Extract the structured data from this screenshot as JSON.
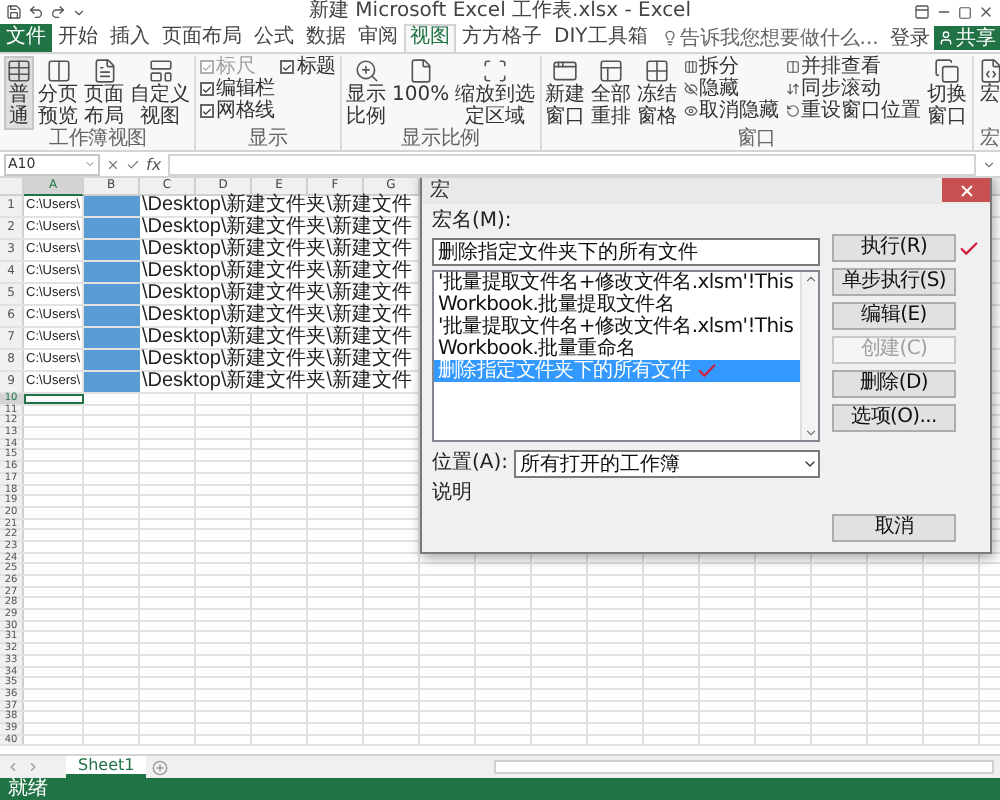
{
  "window": {
    "title": "新建 Microsoft Excel 工作表.xlsx - Excel"
  },
  "tabs": [
    {
      "label": "文件",
      "kind": "file",
      "selected": false
    },
    {
      "label": "开始",
      "kind": "tab",
      "selected": false
    },
    {
      "label": "插入",
      "kind": "tab",
      "selected": false
    },
    {
      "label": "页面布局",
      "kind": "tab",
      "selected": false
    },
    {
      "label": "公式",
      "kind": "tab",
      "selected": false
    },
    {
      "label": "数据",
      "kind": "tab",
      "selected": false
    },
    {
      "label": "审阅",
      "kind": "tab",
      "selected": false
    },
    {
      "label": "视图",
      "kind": "tab",
      "selected": true
    },
    {
      "label": "方方格子",
      "kind": "tab",
      "selected": false
    },
    {
      "label": "DIY工具箱",
      "kind": "tab",
      "selected": false
    }
  ],
  "tell_me": {
    "placeholder": "告诉我您想要做什么..."
  },
  "sign_in": "登录",
  "share": "共享",
  "ribbon": {
    "groups": [
      {
        "label": "工作簿视图",
        "items": [
          {
            "kind": "large",
            "label": "普通",
            "selected": true
          },
          {
            "kind": "large",
            "label": "分页预览",
            "selected": false
          },
          {
            "kind": "large",
            "label": "页面布局",
            "selected": false
          },
          {
            "kind": "large",
            "label": "自定义视图",
            "selected": false
          }
        ]
      },
      {
        "label": "显示",
        "items": [
          {
            "kind": "stack",
            "items": [
              {
                "kind": "check",
                "label": "标尺",
                "checked": true,
                "disabled": true
              },
              {
                "kind": "check",
                "label": "编辑栏",
                "checked": true,
                "disabled": false
              },
              {
                "kind": "check",
                "label": "网格线",
                "checked": true,
                "disabled": false
              }
            ]
          },
          {
            "kind": "stack",
            "items": [
              {
                "kind": "check",
                "label": "标题",
                "checked": true,
                "disabled": false
              }
            ]
          }
        ]
      },
      {
        "label": "显示比例",
        "items": [
          {
            "kind": "large",
            "label": "显示比例"
          },
          {
            "kind": "large",
            "label": "100%"
          },
          {
            "kind": "large",
            "label": "缩放到选定区域"
          }
        ]
      },
      {
        "label": "窗口",
        "items": [
          {
            "kind": "large",
            "label": "新建窗口"
          },
          {
            "kind": "large",
            "label": "全部重排"
          },
          {
            "kind": "large",
            "label": "冻结窗格"
          },
          {
            "kind": "stack",
            "items": [
              {
                "kind": "small",
                "label": "拆分"
              },
              {
                "kind": "small",
                "label": "隐藏"
              },
              {
                "kind": "small",
                "label": "取消隐藏"
              }
            ]
          },
          {
            "kind": "stack",
            "items": [
              {
                "kind": "small",
                "label": "并排查看"
              },
              {
                "kind": "small",
                "label": "同步滚动"
              },
              {
                "kind": "small",
                "label": "重设窗口位置"
              }
            ]
          },
          {
            "kind": "large",
            "label": "切换窗口"
          }
        ]
      },
      {
        "label": "宏",
        "items": [
          {
            "kind": "large",
            "label": "宏"
          }
        ]
      }
    ]
  },
  "formula_bar": {
    "name_box": "A10",
    "fx": "fx"
  },
  "grid": {
    "columns": [
      {
        "label": "A",
        "selected": true
      },
      {
        "label": "B",
        "selected": false
      },
      {
        "label": "C",
        "selected": false
      },
      {
        "label": "D",
        "selected": false
      },
      {
        "label": "E",
        "selected": false
      },
      {
        "label": "F",
        "selected": false
      },
      {
        "label": "G",
        "selected": false
      }
    ],
    "rows": [
      {
        "number": "1",
        "a": "C:\\Users\\",
        "b_filled": true,
        "c": "\\Desktop\\新建文件夹\\新建文件",
        "active": false
      },
      {
        "number": "2",
        "a": "C:\\Users\\",
        "b_filled": true,
        "c": "\\Desktop\\新建文件夹\\新建文件",
        "active": false
      },
      {
        "number": "3",
        "a": "C:\\Users\\",
        "b_filled": true,
        "c": "\\Desktop\\新建文件夹\\新建文件",
        "active": false
      },
      {
        "number": "4",
        "a": "C:\\Users\\",
        "b_filled": true,
        "c": "\\Desktop\\新建文件夹\\新建文件",
        "active": false
      },
      {
        "number": "5",
        "a": "C:\\Users\\",
        "b_filled": true,
        "c": "\\Desktop\\新建文件夹\\新建文件",
        "active": false
      },
      {
        "number": "6",
        "a": "C:\\Users\\",
        "b_filled": true,
        "c": "\\Desktop\\新建文件夹\\新建文件",
        "active": false
      },
      {
        "number": "7",
        "a": "C:\\Users\\",
        "b_filled": true,
        "c": "\\Desktop\\新建文件夹\\新建文件",
        "active": false
      },
      {
        "number": "8",
        "a": "C:\\Users\\",
        "b_filled": true,
        "c": "\\Desktop\\新建文件夹\\新建文件",
        "active": false
      },
      {
        "number": "9",
        "a": "C:\\Users\\",
        "b_filled": true,
        "c": "\\Desktop\\新建文件夹\\新建文件",
        "active": false
      },
      {
        "number": "10",
        "b_filled": false,
        "active": true
      },
      {
        "number": "11",
        "b_filled": false,
        "active": false
      },
      {
        "number": "12",
        "b_filled": false,
        "active": false
      },
      {
        "number": "13",
        "b_filled": false,
        "active": false
      },
      {
        "number": "14",
        "b_filled": false,
        "active": false
      },
      {
        "number": "15",
        "b_filled": false,
        "active": false
      },
      {
        "number": "16",
        "b_filled": false,
        "active": false
      },
      {
        "number": "17",
        "b_filled": false,
        "active": false
      },
      {
        "number": "18",
        "b_filled": false,
        "active": false
      },
      {
        "number": "19",
        "b_filled": false,
        "active": false
      },
      {
        "number": "20",
        "b_filled": false,
        "active": false
      },
      {
        "number": "21",
        "b_filled": false,
        "active": false
      },
      {
        "number": "22",
        "b_filled": false,
        "active": false
      },
      {
        "number": "23",
        "b_filled": false,
        "active": false
      },
      {
        "number": "24",
        "b_filled": false,
        "active": false
      },
      {
        "number": "25",
        "b_filled": false,
        "active": false
      },
      {
        "number": "26",
        "b_filled": false,
        "active": false
      },
      {
        "number": "27",
        "b_filled": false,
        "active": false
      },
      {
        "number": "28",
        "b_filled": false,
        "active": false
      },
      {
        "number": "29",
        "b_filled": false,
        "active": false
      },
      {
        "number": "30",
        "b_filled": false,
        "active": false
      },
      {
        "number": "31",
        "b_filled": false,
        "active": false
      },
      {
        "number": "32",
        "b_filled": false,
        "active": false
      },
      {
        "number": "33",
        "b_filled": false,
        "active": false
      },
      {
        "number": "34",
        "b_filled": false,
        "active": false
      },
      {
        "number": "35",
        "b_filled": false,
        "active": false
      },
      {
        "number": "36",
        "b_filled": false,
        "active": false
      },
      {
        "number": "37",
        "b_filled": false,
        "active": false
      },
      {
        "number": "38",
        "b_filled": false,
        "active": false
      },
      {
        "number": "39",
        "b_filled": false,
        "active": false
      },
      {
        "number": "40",
        "b_filled": false,
        "active": false
      }
    ]
  },
  "dialog": {
    "title": "宏",
    "macro_name_label": "宏名(M):",
    "macro_name": "删除指定文件夹下的所有文件",
    "macros": [
      {
        "label": "'批量提取文件名+修改文件名.xlsm'!ThisWorkbook.批量提取文件名",
        "selected": false
      },
      {
        "label": "'批量提取文件名+修改文件名.xlsm'!ThisWorkbook.批量重命名",
        "selected": false
      },
      {
        "label": "删除指定文件夹下的所有文件",
        "selected": true
      }
    ],
    "location_label": "位置(A):",
    "location": "所有打开的工作簿",
    "description_label": "说明",
    "buttons": [
      {
        "label": "执行(R)",
        "disabled": false
      },
      {
        "label": "单步执行(S)",
        "disabled": false
      },
      {
        "label": "编辑(E)",
        "disabled": false
      },
      {
        "label": "创建(C)",
        "disabled": true
      },
      {
        "label": "删除(D)",
        "disabled": false
      },
      {
        "label": "选项(O)...",
        "disabled": false
      }
    ],
    "cancel": "取消"
  },
  "sheets": [
    {
      "label": "Sheet1",
      "selected": true
    }
  ],
  "status": "就绪"
}
